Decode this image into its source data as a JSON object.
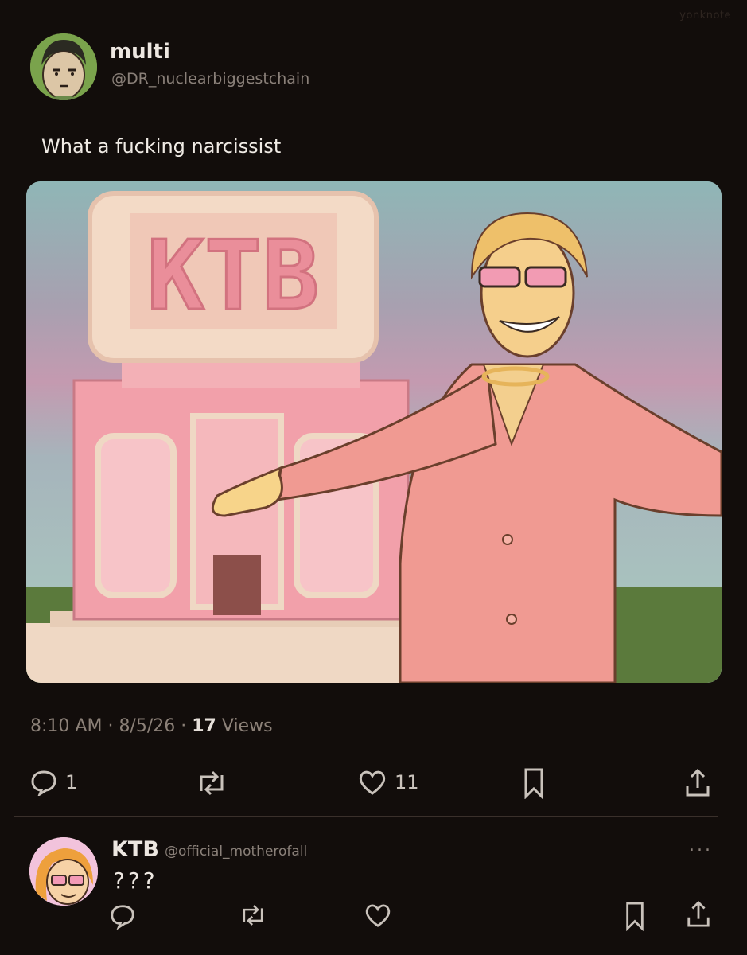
{
  "watermark": "yonknote",
  "tweet": {
    "display_name": "multi",
    "handle": "@DR_nuclearbiggestchain",
    "text": "What a fucking narcissist",
    "image": {
      "sign_text": "KTB"
    },
    "meta": {
      "time": "8:10 AM",
      "date": "8/5/26",
      "views_count": "17",
      "views_label": "Views"
    },
    "actions": {
      "replies": "1",
      "likes": "11"
    }
  },
  "reply": {
    "display_name": "KTB",
    "handle": "@official_motherofall",
    "text": "???",
    "more": "..."
  },
  "colors": {
    "background": "#120d0b",
    "suit_pink": "#f09a92",
    "building_pink": "#f2a3aa"
  },
  "icons": [
    "reply-icon",
    "retweet-icon",
    "heart-icon",
    "bookmark-icon",
    "share-icon",
    "more-icon"
  ]
}
